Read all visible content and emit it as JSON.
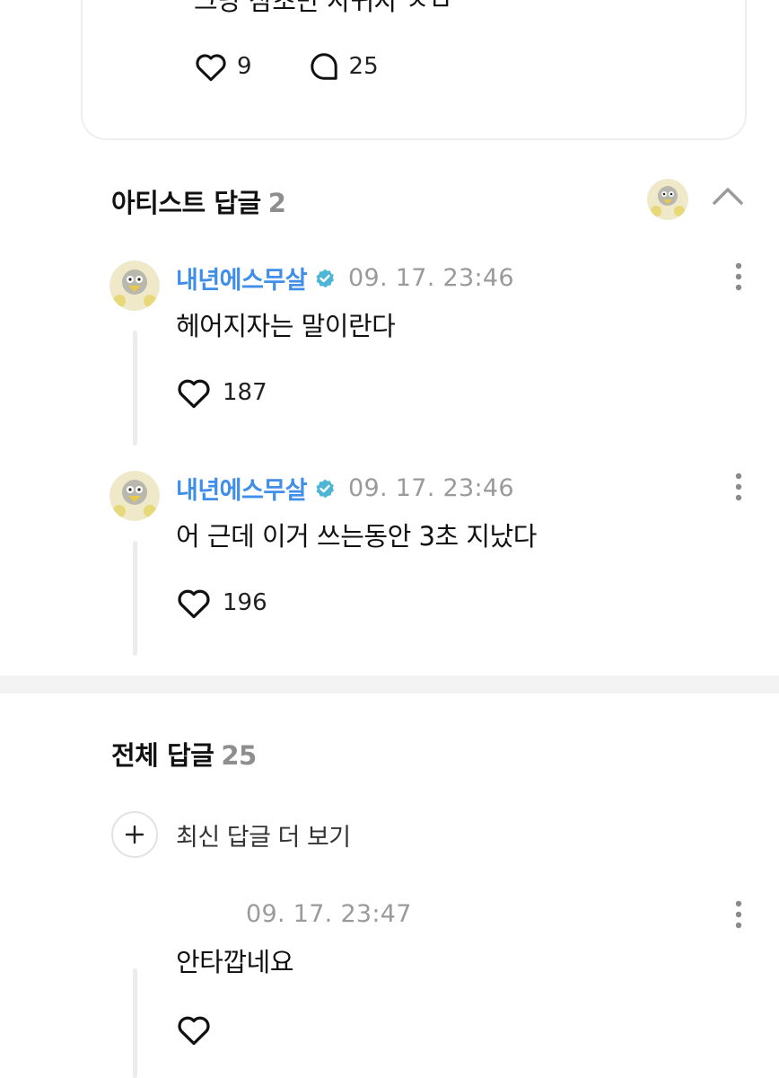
{
  "post": {
    "text": "그냥 삼초만 사귀자 ㅈㅂ",
    "likes": "9",
    "comments": "25"
  },
  "artist_section": {
    "title": "아티스트 답글",
    "count": "2"
  },
  "artist_replies": [
    {
      "author": "내년에스무살",
      "time": "09. 17. 23:46",
      "text": "헤어지자는 말이란다",
      "likes": "187"
    },
    {
      "author": "내년에스무살",
      "time": "09. 17. 23:46",
      "text": "어 근데 이거 쓰는동안 3초 지났다",
      "likes": "196"
    }
  ],
  "all_section": {
    "title": "전체 답글",
    "count": "25",
    "more_label": "최신 답글 더 보기"
  },
  "all_replies": [
    {
      "author": "",
      "time": "09. 17. 23:47",
      "text": "안타깝네요",
      "likes": ""
    }
  ],
  "colors": {
    "author_blue": "#3f8ee9",
    "verified_teal": "#4db6d6",
    "muted_gray": "#9a9a9a",
    "thread_line": "#ececec"
  },
  "icons": [
    "heart-icon",
    "comment-bubble-icon",
    "chevron-up-icon",
    "verified-badge-icon",
    "more-vertical-icon",
    "plus-icon"
  ]
}
